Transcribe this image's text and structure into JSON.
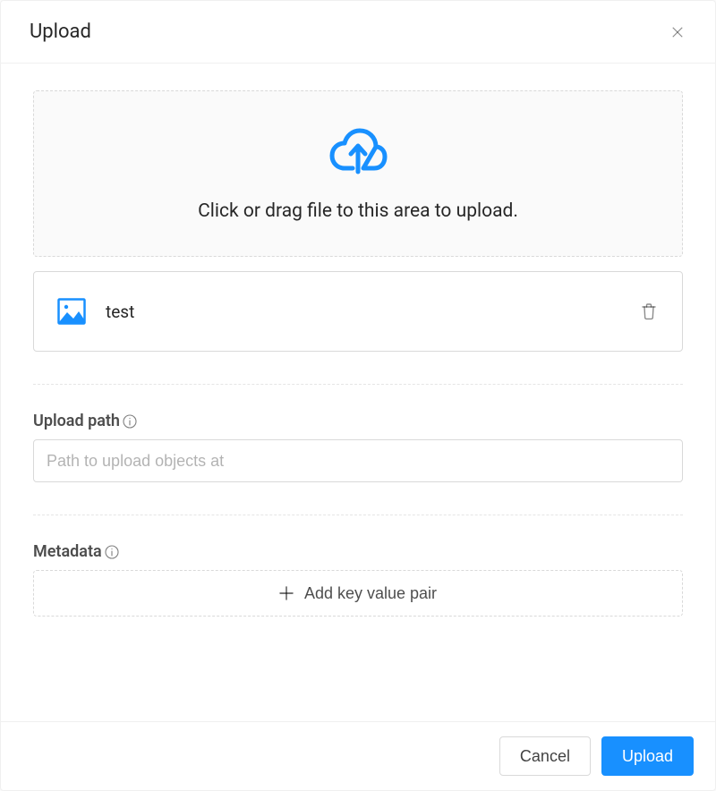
{
  "header": {
    "title": "Upload"
  },
  "dropzone": {
    "text": "Click or drag file to this area to upload."
  },
  "files": [
    {
      "name": "test"
    }
  ],
  "uploadPath": {
    "label": "Upload path",
    "placeholder": "Path to upload objects at",
    "value": ""
  },
  "metadata": {
    "label": "Metadata",
    "addLabel": "Add key value pair"
  },
  "footer": {
    "cancel": "Cancel",
    "upload": "Upload"
  }
}
